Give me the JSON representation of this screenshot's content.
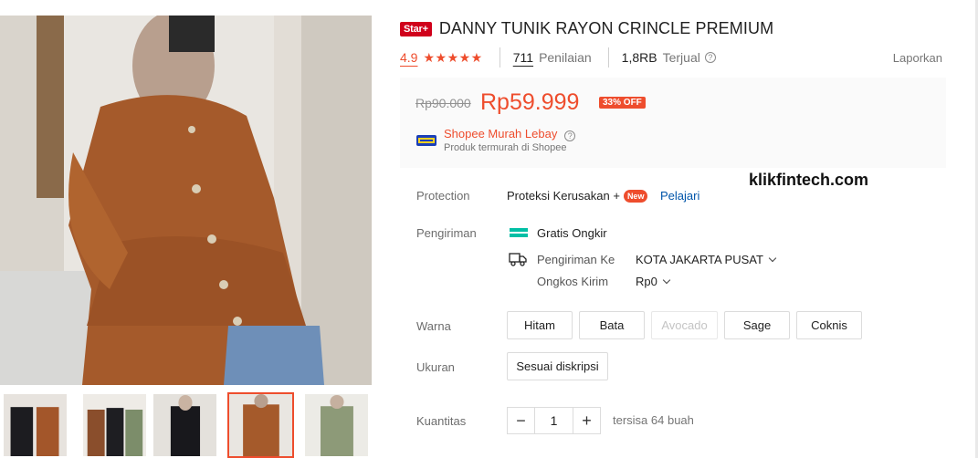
{
  "product": {
    "badge": "Star+",
    "title": "DANNY TUNIK RAYON CRINCLE PREMIUM",
    "rating": "4.9",
    "stars": "★★★★★",
    "reviews_count": "711",
    "reviews_label": "Penilaian",
    "sold_count": "1,8RB",
    "sold_label": "Terjual",
    "report_label": "Laporkan"
  },
  "price": {
    "original": "Rp90.000",
    "current": "Rp59.999",
    "discount": "33% OFF"
  },
  "promo": {
    "title": "Shopee Murah Lebay",
    "subtitle": "Produk termurah di Shopee"
  },
  "watermark": "klikfintech.com",
  "protection": {
    "label": "Protection",
    "value": "Proteksi Kerusakan +",
    "badge": "New",
    "link": "Pelajari"
  },
  "shipping": {
    "label": "Pengiriman",
    "free": "Gratis Ongkir",
    "to_label": "Pengiriman Ke",
    "to_value": "KOTA JAKARTA PUSAT",
    "cost_label": "Ongkos Kirim",
    "cost_value": "Rp0"
  },
  "color": {
    "label": "Warna",
    "options": [
      "Hitam",
      "Bata",
      "Avocado",
      "Sage",
      "Coknis"
    ]
  },
  "size": {
    "label": "Ukuran",
    "options": [
      "Sesuai diskripsi"
    ]
  },
  "quantity": {
    "label": "Kuantitas",
    "value": "1",
    "minus": "−",
    "plus": "+",
    "stock": "tersisa 64 buah"
  },
  "icons": {
    "help": "help-circle-icon",
    "truck": "truck-icon",
    "chevron": "chevron-down-icon"
  },
  "colors": {
    "accent": "#ee4d2d",
    "link": "#0055aa"
  }
}
